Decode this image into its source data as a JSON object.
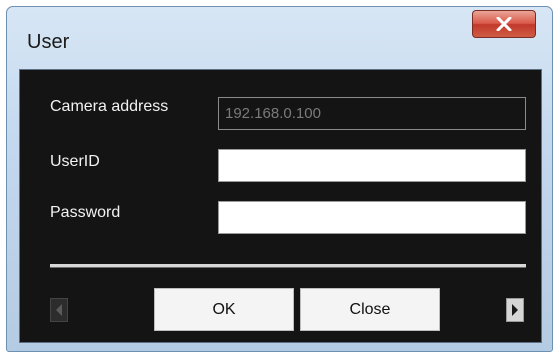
{
  "window": {
    "title": "User"
  },
  "form": {
    "camera_address_label": "Camera address",
    "camera_address_value": "192.168.0.100",
    "userid_label": "UserID",
    "userid_value": "",
    "password_label": "Password",
    "password_value": ""
  },
  "buttons": {
    "ok_label": "OK",
    "close_label": "Close"
  },
  "icons": {
    "window_close": "close-icon",
    "prev": "arrow-left-icon",
    "next": "arrow-right-icon"
  },
  "colors": {
    "dialog_background": "#141414",
    "title_bar": "#c3d8ee",
    "close_button": "#d9584a"
  }
}
